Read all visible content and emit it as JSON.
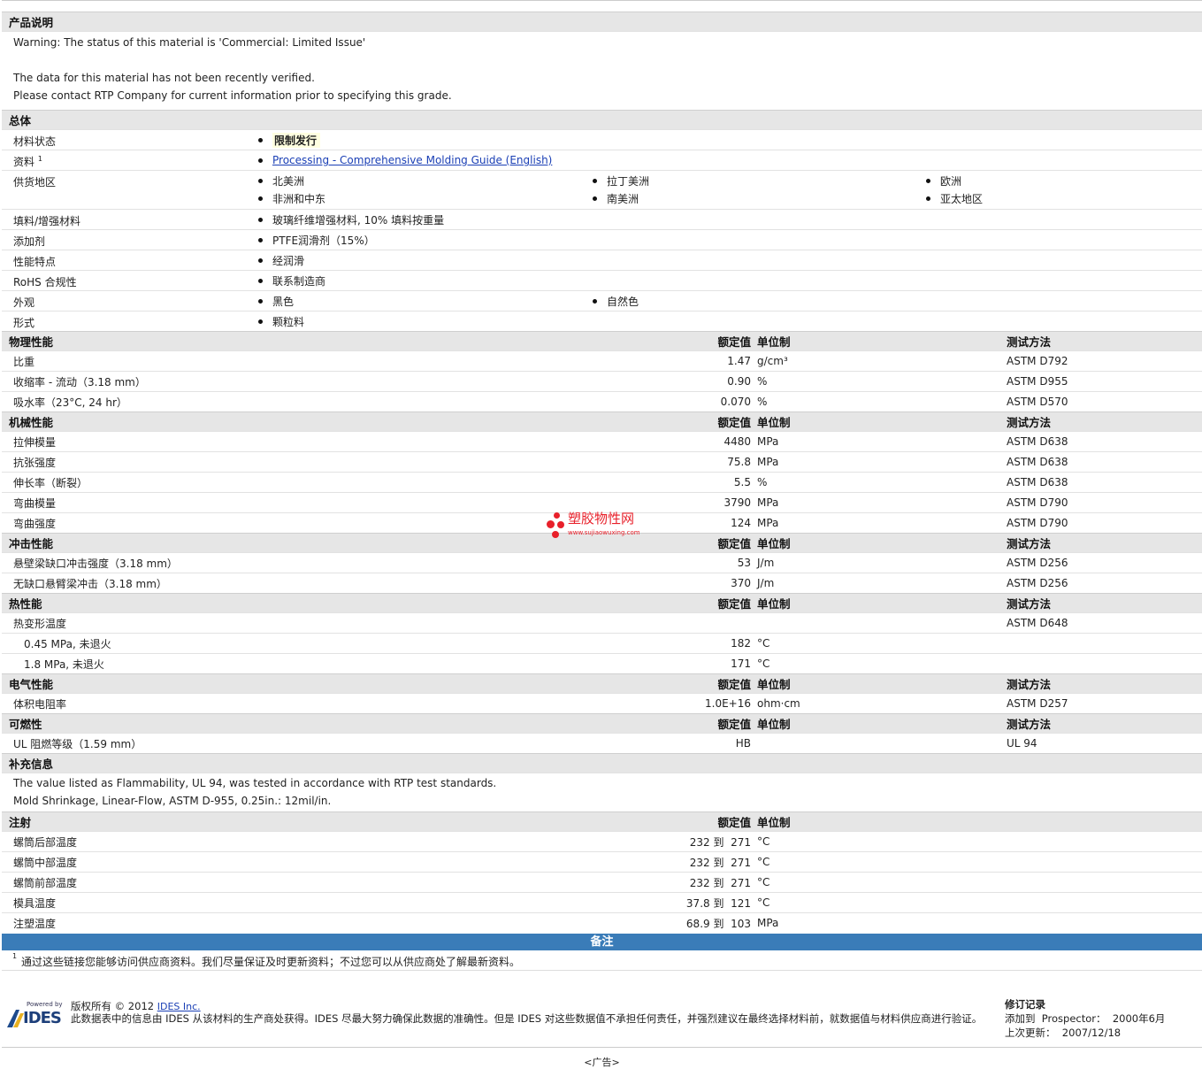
{
  "sections": {
    "description": {
      "title": "产品说明",
      "lines": [
        "Warning: The status of this material is 'Commercial: Limited Issue'",
        "The data for this material has not been recently verified.",
        "Please contact RTP Company for current information prior to specifying this grade."
      ]
    },
    "general": {
      "title": "总体",
      "rows": [
        {
          "label": "材料状态",
          "items": [
            "限制发行"
          ]
        },
        {
          "label": "资料",
          "sup": "1",
          "items": [
            "Processing - Comprehensive Molding Guide (English)"
          ]
        },
        {
          "label": "供货地区",
          "items": [
            "北美洲",
            "拉丁美洲",
            "欧洲",
            "非洲和中东",
            "南美洲",
            "亚太地区"
          ]
        },
        {
          "label": "填料/增强材料",
          "items": [
            "玻璃纤维增强材料, 10% 填料按重量"
          ]
        },
        {
          "label": "添加剂",
          "items": [
            "PTFE润滑剂（15%）"
          ]
        },
        {
          "label": "性能特点",
          "items": [
            "经润滑"
          ]
        },
        {
          "label": "RoHS 合规性",
          "items": [
            "联系制造商"
          ]
        },
        {
          "label": "外观",
          "items": [
            "黑色",
            "自然色"
          ]
        },
        {
          "label": "形式",
          "items": [
            "颗粒料"
          ]
        }
      ]
    },
    "headers": {
      "value": "额定值",
      "unit": "单位制",
      "test": "测试方法"
    },
    "physical": {
      "title": "物理性能",
      "rows": [
        {
          "label": "比重",
          "value": "1.47",
          "unit": "g/cm³",
          "test": "ASTM D792"
        },
        {
          "label": "收缩率  - 流动（3.18 mm）",
          "value": "0.90",
          "unit": "%",
          "test": "ASTM D955"
        },
        {
          "label": "吸水率（23°C, 24 hr）",
          "value": "0.070",
          "unit": "%",
          "test": "ASTM D570"
        }
      ]
    },
    "mechanical": {
      "title": "机械性能",
      "rows": [
        {
          "label": "拉伸模量",
          "value": "4480",
          "unit": "MPa",
          "test": "ASTM D638"
        },
        {
          "label": "抗张强度",
          "value": "75.8",
          "unit": "MPa",
          "test": "ASTM D638"
        },
        {
          "label": "伸长率（断裂）",
          "value": "5.5",
          "unit": "%",
          "test": "ASTM D638"
        },
        {
          "label": "弯曲模量",
          "value": "3790",
          "unit": "MPa",
          "test": "ASTM D790"
        },
        {
          "label": "弯曲强度",
          "value": "124",
          "unit": "MPa",
          "test": "ASTM D790"
        }
      ]
    },
    "impact": {
      "title": "冲击性能",
      "rows": [
        {
          "label": "悬壁梁缺口冲击强度（3.18 mm）",
          "value": "53",
          "unit": "J/m",
          "test": "ASTM D256"
        },
        {
          "label": "无缺口悬臂梁冲击（3.18 mm）",
          "value": "370",
          "unit": "J/m",
          "test": "ASTM D256"
        }
      ]
    },
    "thermal": {
      "title": "热性能",
      "rows": [
        {
          "label": "热变形温度",
          "value": "",
          "unit": "",
          "test": "ASTM D648"
        },
        {
          "label": "0.45 MPa, 未退火",
          "sub": true,
          "value": "182",
          "unit": "°C",
          "test": ""
        },
        {
          "label": "1.8 MPa, 未退火",
          "sub": true,
          "value": "171",
          "unit": "°C",
          "test": ""
        }
      ]
    },
    "electrical": {
      "title": "电气性能",
      "rows": [
        {
          "label": "体积电阻率",
          "value": "1.0E+16",
          "unit": "ohm·cm",
          "test": "ASTM D257"
        }
      ]
    },
    "flammability": {
      "title": "可燃性",
      "rows": [
        {
          "label": "UL 阻燃等级（1.59 mm）",
          "value": "HB",
          "unit": "",
          "test": "UL 94"
        }
      ]
    },
    "supplement": {
      "title": "补充信息",
      "lines": [
        "The value listed as Flammability, UL 94, was tested in accordance with RTP test standards.",
        "Mold Shrinkage, Linear-Flow, ASTM D-955, 0.25in.: 12mil/in."
      ]
    },
    "injection": {
      "title": "注射",
      "rows": [
        {
          "label": "螺筒后部温度",
          "value": "232 到  271",
          "unit": "°C"
        },
        {
          "label": "螺筒中部温度",
          "value": "232 到  271",
          "unit": "°C"
        },
        {
          "label": "螺筒前部温度",
          "value": "232 到  271",
          "unit": "°C"
        },
        {
          "label": "模具温度",
          "value": "37.8 到  121",
          "unit": "°C"
        },
        {
          "label": "注塑温度",
          "value": "68.9 到  103",
          "unit": "MPa"
        }
      ]
    }
  },
  "notes": {
    "title": "备注",
    "footnote_mark": "1",
    "footnote": "通过这些链接您能够访问供应商资料。我们尽量保证及时更新资料；不过您可以从供应商处了解最新资料。"
  },
  "footer": {
    "logo_powered": "Powered by",
    "logo_text": "IDES",
    "copyright": "版权所有 © 2012",
    "company_link": "IDES Inc.",
    "disclaimer": "此数据表中的信息由  IDES 从该材料的生产商处获得。IDES 尽最大努力确保此数据的准确性。但是  IDES 对这些数据值不承担任何责任，并强烈建议在最终选择材料前，就数据值与材料供应商进行验证。",
    "revision_title": "修订记录",
    "added": "添加到  Prospector：  2000年6月",
    "updated": "上次更新：  2007/12/18"
  },
  "watermark": {
    "text": "塑胶物性网",
    "url": "www.sujiaowuxing.com"
  },
  "ad": "<广告>"
}
